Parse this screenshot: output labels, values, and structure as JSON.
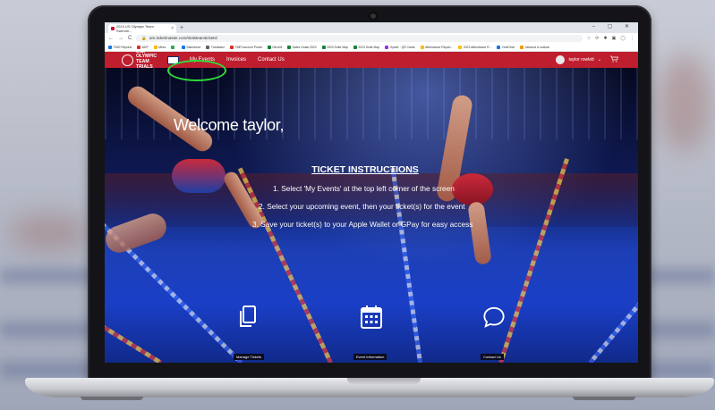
{
  "browser": {
    "tab_title": "2024 US Olympic Team Swimmi...",
    "tab_close": "×",
    "new_tab": "+",
    "window_controls": "– ▢ ✕",
    "address": "am.ticketmaster.com/trialsteamtickets/",
    "nav_glyphs": {
      "back": "←",
      "forward": "→",
      "reload": "C"
    },
    "toolbar_icons": [
      "☆",
      "⟳",
      "✱",
      "▣",
      "◯",
      "⋮"
    ],
    "bookmarks": [
      {
        "label": "TWO Reports",
        "color": "#1a73e8"
      },
      {
        "label": "ADP",
        "color": "#d93025"
      },
      {
        "label": "Mess",
        "color": "#fbbc04"
      },
      {
        "label": "",
        "color": "#34a853"
      },
      {
        "label": "Salesforce",
        "color": "#1a73e8"
      },
      {
        "label": "Translator",
        "color": "#5f6368"
      },
      {
        "label": "TMR Account Portal",
        "color": "#d93025"
      },
      {
        "label": "Old AM",
        "color": "#188038"
      },
      {
        "label": "Sales Goals 2023",
        "color": "#188038"
      },
      {
        "label": "2023 Suite Map",
        "color": "#188038"
      },
      {
        "label": "2023 Suite Map",
        "color": "#188038"
      },
      {
        "label": "Oyster - QR Cards",
        "color": "#9334e6"
      },
      {
        "label": "Attendance Report...",
        "color": "#fbbc04"
      },
      {
        "label": "2023 Attendance R...",
        "color": "#fbbc04"
      },
      {
        "label": "OneDrive",
        "color": "#1a73e8"
      },
      {
        "label": "Inbound & outlook",
        "color": "#f29900"
      }
    ]
  },
  "site": {
    "logo_line1": "U.S. OLYMPIC",
    "logo_line2": "TEAM TRIALS",
    "nav": [
      "My Events",
      "Invoices",
      "Contact Us"
    ],
    "user_name": "taylor rowlett",
    "user_chevron": "⌄"
  },
  "hero": {
    "welcome": "Welcome taylor,",
    "instructions_title": "TICKET INSTRUCTIONS",
    "instructions": [
      "1. Select 'My Events' at the top left corner of the screen",
      "2. Select your upcoming event, then your ticket(s) for the event",
      "3. Save your ticket(s) to your Apple Wallet or GPay for easy access"
    ],
    "actions": [
      "Manage Tickets",
      "Event Information",
      "Contact Us"
    ]
  },
  "colors": {
    "nav_red": "#bf1e2e",
    "highlight_green": "#2fdc3a",
    "pool_blue": "#1d3fb6"
  }
}
